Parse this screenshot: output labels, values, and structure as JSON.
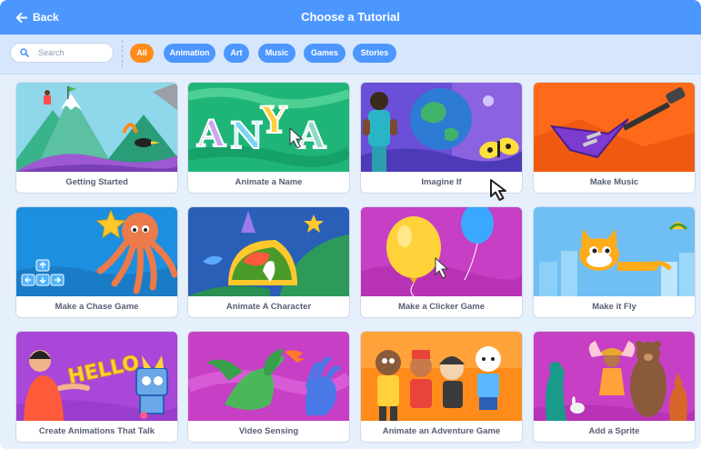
{
  "header": {
    "back_label": "Back",
    "title": "Choose a Tutorial"
  },
  "filter": {
    "search_placeholder": "Search",
    "tags": [
      {
        "label": "All",
        "active": true
      },
      {
        "label": "Animation",
        "active": false
      },
      {
        "label": "Art",
        "active": false
      },
      {
        "label": "Music",
        "active": false
      },
      {
        "label": "Games",
        "active": false
      },
      {
        "label": "Stories",
        "active": false
      }
    ]
  },
  "tutorials": [
    {
      "title": "Getting Started"
    },
    {
      "title": "Animate a Name",
      "art_text": "ANYA"
    },
    {
      "title": "Imagine If"
    },
    {
      "title": "Make Music"
    },
    {
      "title": "Make a Chase Game"
    },
    {
      "title": "Animate A Character"
    },
    {
      "title": "Make a Clicker Game"
    },
    {
      "title": "Make it Fly"
    },
    {
      "title": "Create Animations That Talk",
      "art_text": "HELLO"
    },
    {
      "title": "Video Sensing"
    },
    {
      "title": "Animate an Adventure Game"
    },
    {
      "title": "Add a Sprite"
    }
  ],
  "colors": {
    "header": "#4c97ff",
    "filter_bar": "#d6e6fd",
    "active_tag": "#ff8c1a",
    "tag": "#4c97ff",
    "label_text": "#575e75"
  },
  "icons": {
    "back": "arrow-left-icon",
    "search": "search-icon",
    "cursor": "mouse-pointer-icon"
  }
}
